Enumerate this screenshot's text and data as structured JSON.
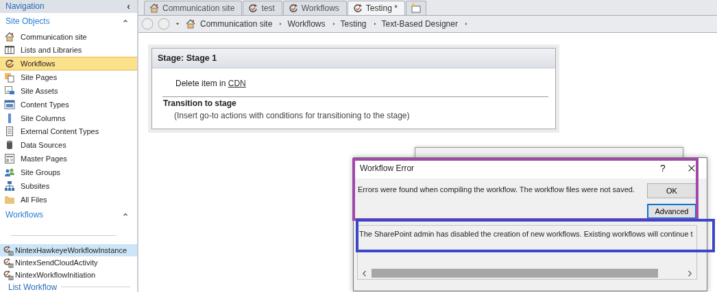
{
  "navigation": {
    "title": "Navigation",
    "collapse": "‹"
  },
  "site_objects": {
    "title": "Site Objects",
    "items": [
      {
        "label": "Communication site",
        "selected": false
      },
      {
        "label": "Lists and Libraries",
        "selected": false
      },
      {
        "label": "Workflows",
        "selected": true
      },
      {
        "label": "Site Pages",
        "selected": false
      },
      {
        "label": "Site Assets",
        "selected": false
      },
      {
        "label": "Content Types",
        "selected": false
      },
      {
        "label": "Site Columns",
        "selected": false
      },
      {
        "label": "External Content Types",
        "selected": false
      },
      {
        "label": "Data Sources",
        "selected": false
      },
      {
        "label": "Master Pages",
        "selected": false
      },
      {
        "label": "Site Groups",
        "selected": false
      },
      {
        "label": "Subsites",
        "selected": false
      },
      {
        "label": "All Files",
        "selected": false
      }
    ]
  },
  "workflows": {
    "title": "Workflows",
    "items": [
      {
        "label": "NintexHawkeyeWorkflowInstance",
        "selected": true
      },
      {
        "label": "NintexSendCloudActivity",
        "selected": false
      },
      {
        "label": "NintexWorkflowInitiation",
        "selected": false
      }
    ],
    "group": "List Workflow"
  },
  "tabs": [
    {
      "label": "Communication site",
      "selected": false
    },
    {
      "label": "test",
      "selected": false
    },
    {
      "label": "Workflows",
      "selected": false
    },
    {
      "label": "Testing *",
      "selected": true
    }
  ],
  "breadcrumb": [
    "Communication site",
    "Workflows",
    "Testing",
    "Text-Based Designer"
  ],
  "stage": {
    "title": "Stage: Stage 1",
    "action": "Delete item in",
    "link": "CDN",
    "transition_title": "Transition to stage",
    "transition_hint": "(Insert go-to actions with conditions for transitioning to the stage)"
  },
  "dialog": {
    "title": "Workflow Error",
    "help": "?",
    "message": "Errors were found when compiling the workflow. The workflow files were not saved.",
    "buttons": [
      "OK",
      "Advanced"
    ],
    "details": "The SharePoint admin has disabled the creation of new workflows. Existing workflows will continue t"
  }
}
